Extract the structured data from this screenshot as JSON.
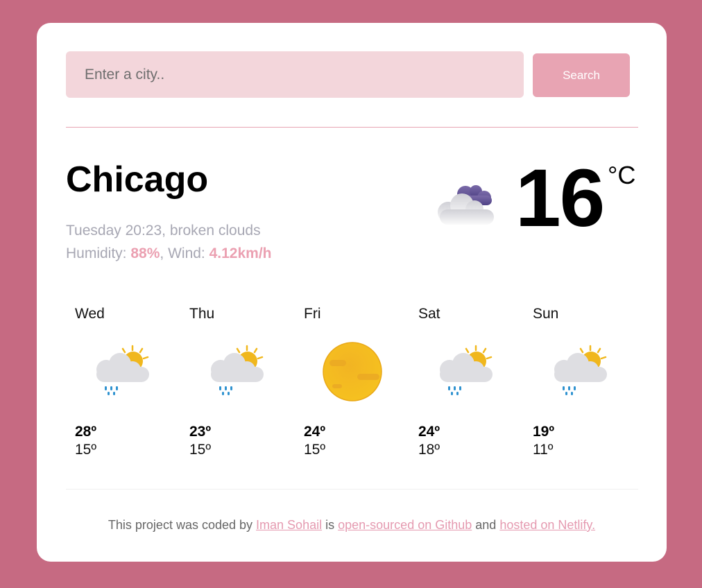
{
  "search": {
    "placeholder": "Enter a city..",
    "button_label": "Search"
  },
  "current": {
    "city": "Chicago",
    "day_time": "Tuesday 20:23",
    "description": "broken clouds",
    "humidity_label": "Humidity:",
    "humidity_value": "88%",
    "wind_label": "Wind:",
    "wind_value": "4.12km/h",
    "temperature": "16",
    "unit": "°C",
    "icon": "broken-clouds-icon"
  },
  "forecast": [
    {
      "day": "Wed",
      "max": "28º",
      "min": "15º",
      "icon": "sun-rain-icon"
    },
    {
      "day": "Thu",
      "max": "23º",
      "min": "15º",
      "icon": "sun-rain-icon"
    },
    {
      "day": "Fri",
      "max": "24º",
      "min": "15º",
      "icon": "sun-icon"
    },
    {
      "day": "Sat",
      "max": "24º",
      "min": "18º",
      "icon": "sun-rain-icon"
    },
    {
      "day": "Sun",
      "max": "19º",
      "min": "11º",
      "icon": "sun-rain-icon"
    }
  ],
  "footer": {
    "text_1": "This project was coded by",
    "author_link": "Iman Sohail",
    "text_2": "is",
    "github_link": "open-sourced on Github",
    "text_3": "and",
    "netlify_link": "hosted on Netlify."
  },
  "colors": {
    "background": "#c66a82",
    "accent": "#e8a4b3",
    "input_bg": "#f3d6db",
    "highlight": "#eba0b1"
  }
}
